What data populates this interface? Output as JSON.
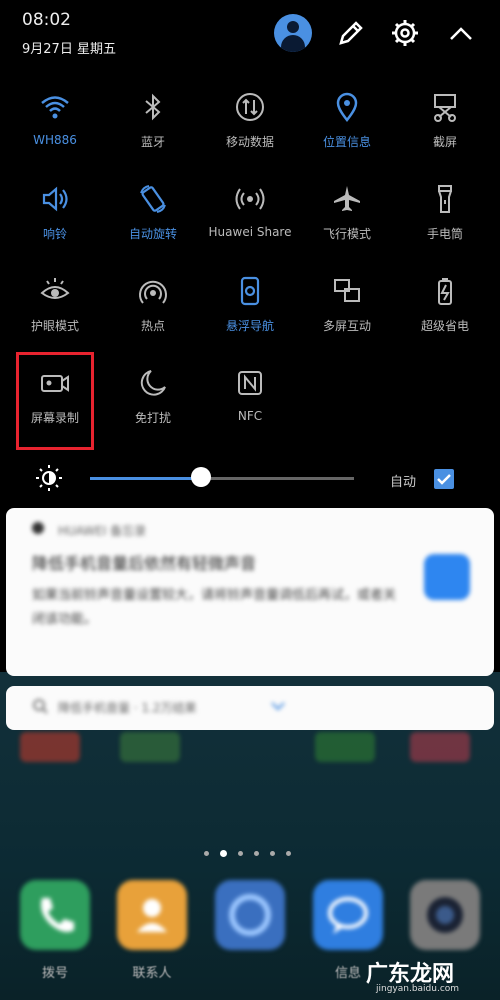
{
  "status": {
    "time": "08:02",
    "date": "9月27日 星期五"
  },
  "tiles": [
    {
      "label": "WH886",
      "icon": "wifi-icon",
      "on": true
    },
    {
      "label": "蓝牙",
      "icon": "bluetooth-icon",
      "on": false
    },
    {
      "label": "移动数据",
      "icon": "mobile-data-icon",
      "on": false
    },
    {
      "label": "位置信息",
      "icon": "location-icon",
      "on": true
    },
    {
      "label": "截屏",
      "icon": "screenshot-icon",
      "on": false
    },
    {
      "label": "响铃",
      "icon": "speaker-icon",
      "on": true
    },
    {
      "label": "自动旋转",
      "icon": "auto-rotate-icon",
      "on": true
    },
    {
      "label": "Huawei Share",
      "icon": "huawei-share-icon",
      "on": false
    },
    {
      "label": "飞行模式",
      "icon": "airplane-icon",
      "on": false
    },
    {
      "label": "手电筒",
      "icon": "flashlight-icon",
      "on": false
    },
    {
      "label": "护眼模式",
      "icon": "eye-icon",
      "on": false
    },
    {
      "label": "热点",
      "icon": "hotspot-icon",
      "on": false
    },
    {
      "label": "悬浮导航",
      "icon": "floating-nav-icon",
      "on": true
    },
    {
      "label": "多屏互动",
      "icon": "multi-screen-icon",
      "on": false
    },
    {
      "label": "超级省电",
      "icon": "battery-saver-icon",
      "on": false
    },
    {
      "label": "屏幕录制",
      "icon": "screen-record-icon",
      "on": false
    },
    {
      "label": "免打扰",
      "icon": "moon-icon",
      "on": false
    },
    {
      "label": "NFC",
      "icon": "nfc-icon",
      "on": false
    }
  ],
  "brightness": {
    "level": 0.42,
    "auto_label": "自动",
    "auto_checked": true
  },
  "notification": {
    "app": "HUAWEI 备忘录",
    "headline": "降低手机音量后依然有轻微声音",
    "body": "如果当前铃声音量设置较大，请将铃声音量调低后再试，或者关闭该功能。"
  },
  "search_hint": "降低手机音量 · 1.2万结果",
  "page_indicator": {
    "count": 6,
    "active": 1
  },
  "dock": [
    {
      "label": "拨号",
      "color": "#2e9e5e"
    },
    {
      "label": "联系人",
      "color": "#e8a13a"
    },
    {
      "label": "",
      "color": "#3a6fbf"
    },
    {
      "label": "信息",
      "color": "#2f7ee0"
    },
    {
      "label": "",
      "color": "#7a7a7a"
    }
  ],
  "watermark": {
    "main": "广东龙网",
    "sub": "jingyan.baidu.com"
  },
  "colors": {
    "accent": "#4a90e2",
    "highlight": "#e8232f"
  }
}
